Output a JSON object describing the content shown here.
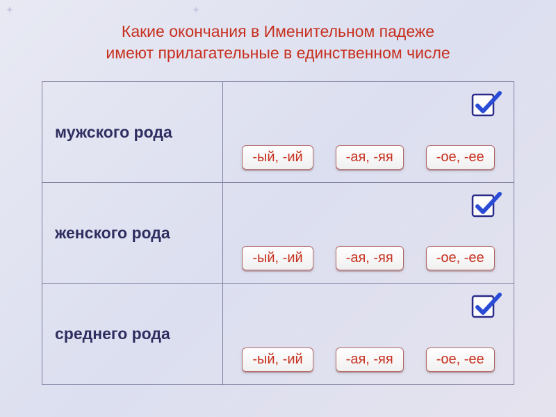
{
  "title_line1": "Какие окончания в Именительном падеже",
  "title_line2": "имеют прилагательные в единственном числе",
  "rows": [
    {
      "label": "мужского рода",
      "options": [
        "-ый, -ий",
        "-ая, -яя",
        "-ое, -ее"
      ]
    },
    {
      "label": "женского рода",
      "options": [
        "-ый, -ий",
        "-ая, -яя",
        "-ое, -ее"
      ]
    },
    {
      "label": "среднего рода",
      "options": [
        "-ый, -ий",
        "-ая, -яя",
        "-ое, -ее"
      ]
    }
  ],
  "icons": {
    "checkbox": "checkbox-with-checkmark"
  }
}
